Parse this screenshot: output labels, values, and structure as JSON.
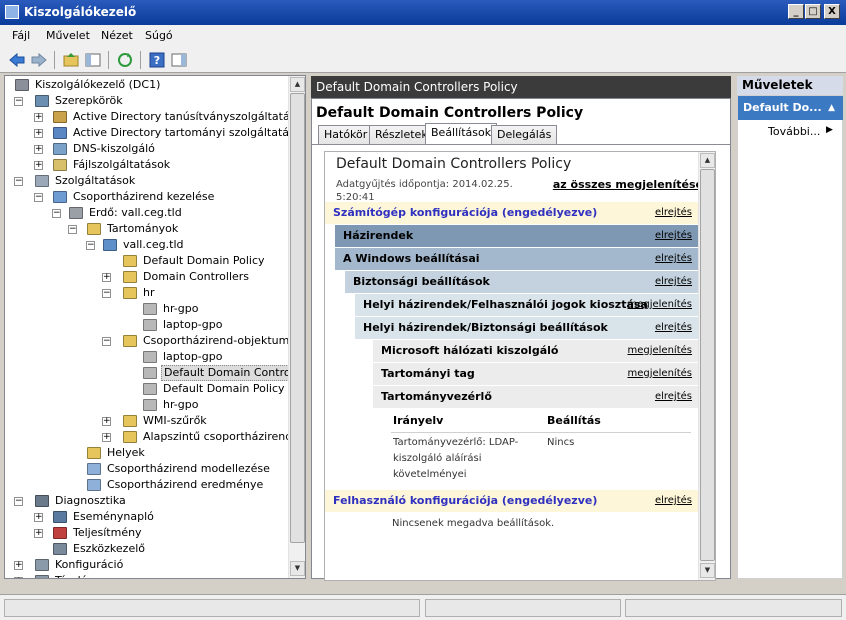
{
  "window": {
    "title": "Kiszolgálókezelő",
    "btn_min": "_",
    "btn_max": "□",
    "btn_close": "X"
  },
  "menu": [
    "Fájl",
    "Művelet",
    "Nézet",
    "Súgó"
  ],
  "tree": [
    {
      "label": "Kiszolgálókezelő (DC1)",
      "depth": 0,
      "exp": "",
      "icon": "server-icon",
      "color": "#8a8f99"
    },
    {
      "label": "Szerepkörök",
      "depth": 1,
      "exp": "−",
      "icon": "roles-icon",
      "color": "#6a8fb0"
    },
    {
      "label": "Active Directory tanúsítványszolgáltatások",
      "depth": 2,
      "exp": "+",
      "icon": "cert-icon",
      "color": "#c9a24a"
    },
    {
      "label": "Active Directory tartományi szolgáltatások",
      "depth": 2,
      "exp": "+",
      "icon": "ad-icon",
      "color": "#5b86c4"
    },
    {
      "label": "DNS-kiszolgáló",
      "depth": 2,
      "exp": "+",
      "icon": "dns-icon",
      "color": "#7aa2c8"
    },
    {
      "label": "Fájlszolgáltatások",
      "depth": 2,
      "exp": "+",
      "icon": "file-services-icon",
      "color": "#d8c06a"
    },
    {
      "label": "Szolgáltatások",
      "depth": 1,
      "exp": "−",
      "icon": "features-icon",
      "color": "#9aa8b8"
    },
    {
      "label": "Csoportházirend kezelése",
      "depth": 2,
      "exp": "−",
      "icon": "gpm-icon",
      "color": "#6f9bd3"
    },
    {
      "label": "Erdő: vall.ceg.tld",
      "depth": 3,
      "exp": "−",
      "icon": "forest-icon",
      "color": "#9aa0a6"
    },
    {
      "label": "Tartományok",
      "depth": 4,
      "exp": "−",
      "icon": "domains-folder-icon",
      "color": "#e5c55c"
    },
    {
      "label": "vall.ceg.tld",
      "depth": 5,
      "exp": "−",
      "icon": "domain-icon",
      "color": "#5f8fc9"
    },
    {
      "label": "Default Domain Policy",
      "depth": 6,
      "exp": "",
      "icon": "gpo-link-icon",
      "color": "#e5c55c"
    },
    {
      "label": "Domain Controllers",
      "depth": 6,
      "exp": "+",
      "icon": "ou-icon",
      "color": "#e5c55c"
    },
    {
      "label": "hr",
      "depth": 6,
      "exp": "−",
      "icon": "ou-icon",
      "color": "#e5c55c"
    },
    {
      "label": "hr-gpo",
      "depth": 7,
      "exp": "",
      "icon": "gpo-icon",
      "color": "#b8b8b8"
    },
    {
      "label": "laptop-gpo",
      "depth": 7,
      "exp": "",
      "icon": "gpo-icon",
      "color": "#b8b8b8"
    },
    {
      "label": "Csoportházirend-objektumok",
      "depth": 6,
      "exp": "−",
      "icon": "gpo-folder-icon",
      "color": "#e5c55c"
    },
    {
      "label": "laptop-gpo",
      "depth": 7,
      "exp": "",
      "icon": "gpo-icon",
      "color": "#b8b8b8"
    },
    {
      "label": "Default Domain Controllers",
      "depth": 7,
      "exp": "",
      "icon": "gpo-icon",
      "color": "#b8b8b8",
      "selected": true
    },
    {
      "label": "Default Domain Policy",
      "depth": 7,
      "exp": "",
      "icon": "gpo-icon",
      "color": "#b8b8b8"
    },
    {
      "label": "hr-gpo",
      "depth": 7,
      "exp": "",
      "icon": "gpo-icon",
      "color": "#b8b8b8"
    },
    {
      "label": "WMI-szűrők",
      "depth": 6,
      "exp": "+",
      "icon": "wmi-folder-icon",
      "color": "#e5c55c"
    },
    {
      "label": "Alapszintű csoportházirend-obj",
      "depth": 6,
      "exp": "+",
      "icon": "starter-gpo-folder-icon",
      "color": "#e5c55c"
    },
    {
      "label": "Helyek",
      "depth": 4,
      "exp": "",
      "icon": "sites-icon",
      "color": "#e5c55c"
    },
    {
      "label": "Csoportházirend modellezése",
      "depth": 4,
      "exp": "",
      "icon": "modeling-icon",
      "color": "#8fb0d8"
    },
    {
      "label": "Csoportházirend eredménye",
      "depth": 4,
      "exp": "",
      "icon": "results-icon",
      "color": "#8fb0d8"
    },
    {
      "label": "Diagnosztika",
      "depth": 1,
      "exp": "−",
      "icon": "diagnostics-icon",
      "color": "#6a7a8a"
    },
    {
      "label": "Eseménynapló",
      "depth": 2,
      "exp": "+",
      "icon": "event-log-icon",
      "color": "#5b7aa0"
    },
    {
      "label": "Teljesítmény",
      "depth": 2,
      "exp": "+",
      "icon": "performance-icon",
      "color": "#c04040"
    },
    {
      "label": "Eszközkezelő",
      "depth": 2,
      "exp": "",
      "icon": "device-manager-icon",
      "color": "#7a8a9a"
    },
    {
      "label": "Konfiguráció",
      "depth": 1,
      "exp": "+",
      "icon": "configuration-icon",
      "color": "#8a9aa8"
    },
    {
      "label": "Tárolás",
      "depth": 1,
      "exp": "+",
      "icon": "storage-icon",
      "color": "#8a9aa8"
    }
  ],
  "middle": {
    "header": "Default Domain Controllers Policy",
    "title": "Default Domain Controllers Policy",
    "tabs": [
      "Hatókör",
      "Részletek",
      "Beállítások",
      "Delegálás"
    ],
    "active_tab": 2,
    "report": {
      "title": "Default Domain Controllers Policy",
      "date_line1": "Adatgyűjtés időpontja: 2014.02.25.",
      "date_line2": "5:20:41",
      "show_all": "az összes megjelenítése",
      "rows": [
        {
          "label": "Számítógép konfigurációja (engedélyezve)",
          "link": "elrejtés",
          "indent": 0,
          "bg": "#fdf6d8",
          "fg": "#3030c0",
          "bold": true
        },
        {
          "label": "Házirendek",
          "link": "elrejtés",
          "indent": 10,
          "bg": "#7e98b4",
          "fg": "#000",
          "bold": true
        },
        {
          "label": "A Windows beállításai",
          "link": "elrejtés",
          "indent": 10,
          "bg": "#a3b8cc",
          "fg": "#000",
          "bold": true
        },
        {
          "label": "Biztonsági beállítások",
          "link": "elrejtés",
          "indent": 20,
          "bg": "#c3d2de",
          "fg": "#000",
          "bold": true
        },
        {
          "label": "Helyi házirendek/Felhasználói jogok kiosztása",
          "link": "megjelenítés",
          "indent": 30,
          "bg": "#d9e3ea",
          "fg": "#000",
          "bold": true
        },
        {
          "label": "Helyi házirendek/Biztonsági beállítások",
          "link": "elrejtés",
          "indent": 30,
          "bg": "#d9e3ea",
          "fg": "#000",
          "bold": true
        },
        {
          "label": "Microsoft hálózati kiszolgáló",
          "link": "megjelenítés",
          "indent": 48,
          "bg": "#ececec",
          "fg": "#000",
          "bold": true
        },
        {
          "label": "Tartományi tag",
          "link": "megjelenítés",
          "indent": 48,
          "bg": "#ececec",
          "fg": "#000",
          "bold": true
        },
        {
          "label": "Tartományvezérlő",
          "link": "elrejtés",
          "indent": 48,
          "bg": "#ececec",
          "fg": "#000",
          "bold": true
        }
      ],
      "table": {
        "col_policy": "Irányelv",
        "col_setting": "Beállítás",
        "policy_line1": "Tartományvezérlő: LDAP-",
        "policy_line2": "kiszolgáló aláírási",
        "policy_line3": "követelményei",
        "value": "Nincs"
      },
      "user_config": {
        "label": "Felhasználó konfigurációja (engedélyezve)",
        "link": "elrejtés",
        "bg": "#fdf6d8",
        "fg": "#3030c0"
      },
      "no_settings": "Nincsenek megadva beállítások."
    }
  },
  "actions": {
    "header": "Műveletek",
    "selected": "Default Do...",
    "more": "További..."
  }
}
